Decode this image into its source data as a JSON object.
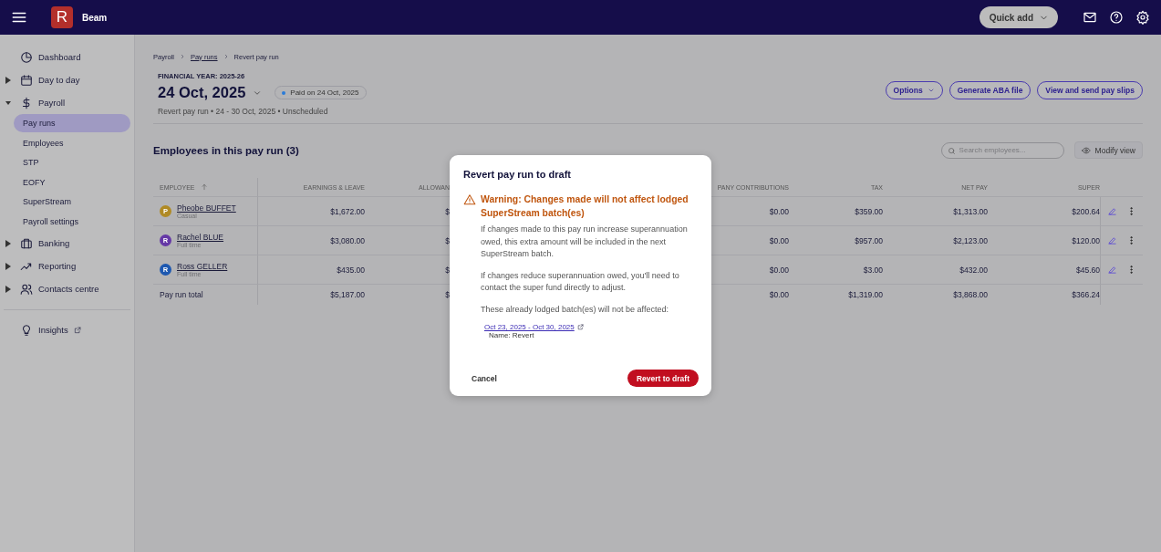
{
  "topbar": {
    "logo_letter": "R",
    "app_name": "Beam",
    "quick_add": "Quick add"
  },
  "sidebar": {
    "items": [
      {
        "label": "Dashboard",
        "kind": "link"
      },
      {
        "label": "Day to day",
        "kind": "group",
        "expanded": false
      },
      {
        "label": "Payroll",
        "kind": "group",
        "expanded": true,
        "children": [
          {
            "label": "Pay runs",
            "selected": true
          },
          {
            "label": "Employees",
            "selected": false
          },
          {
            "label": "STP",
            "selected": false
          },
          {
            "label": "EOFY",
            "selected": false
          },
          {
            "label": "SuperStream",
            "selected": false
          },
          {
            "label": "Payroll settings",
            "selected": false
          }
        ]
      },
      {
        "label": "Banking",
        "kind": "group",
        "expanded": false
      },
      {
        "label": "Reporting",
        "kind": "group",
        "expanded": false
      },
      {
        "label": "Contacts centre",
        "kind": "group",
        "expanded": false
      }
    ],
    "footer_link": {
      "label": "Insights"
    }
  },
  "breadcrumb": [
    {
      "label": "Payroll",
      "kind": "text"
    },
    {
      "label": "Pay runs",
      "kind": "link"
    },
    {
      "label": "Revert pay run",
      "kind": "text"
    }
  ],
  "header": {
    "financial_year": "FINANCIAL YEAR: 2025-26",
    "title": "24 Oct, 2025",
    "status": "Paid on 24 Oct, 2025",
    "subtitle": "Revert pay run • 24 - 30 Oct, 2025 • Unscheduled"
  },
  "actions": [
    {
      "label": "Options",
      "kind": "dropdown"
    },
    {
      "label": "Generate ABA file",
      "kind": "button"
    },
    {
      "label": "View and send pay slips",
      "kind": "button"
    }
  ],
  "section": {
    "title": "Employees in this pay run (3)",
    "search_placeholder": "Search employees...",
    "modify_view": "Modify view"
  },
  "table": {
    "employee_column": {
      "label": "EMPLOYEE",
      "sorted": true
    },
    "columns": [
      {
        "label": "EARNINGS & LEAVE",
        "sorted": false
      },
      {
        "label": "ALLOWAN",
        "sorted": false
      },
      {
        "label": "PANY CONTRIBUTIONS",
        "sorted": false
      },
      {
        "label": "TAX",
        "sorted": false
      },
      {
        "label": "NET PAY",
        "sorted": false
      },
      {
        "label": "SUPER",
        "sorted": false
      }
    ],
    "rows": [
      {
        "initial": "P",
        "color": "#b08a24",
        "name": "Pheobe BUFFET",
        "type": "Casual",
        "cells": [
          "$1,672.00",
          "$",
          "$0.00",
          "$359.00",
          "$1,313.00",
          "$200.64"
        ]
      },
      {
        "initial": "R",
        "color": "#6538a6",
        "name": "Rachel BLUE",
        "type": "Full time",
        "cells": [
          "$3,080.00",
          "$",
          "$0.00",
          "$957.00",
          "$2,123.00",
          "$120.00"
        ]
      },
      {
        "initial": "R",
        "color": "#1d58b0",
        "name": "Ross GELLER",
        "type": "Full time",
        "cells": [
          "$435.00",
          "$",
          "$0.00",
          "$3.00",
          "$432.00",
          "$45.60"
        ]
      }
    ],
    "total": {
      "label": "Pay run total",
      "cells": [
        "$5,187.00",
        "$",
        "$0.00",
        "$1,319.00",
        "$3,868.00",
        "$366.24"
      ]
    }
  },
  "modal": {
    "title": "Revert pay run to draft",
    "warning": "Warning: Changes made will not affect lodged SuperStream batch(es)",
    "paragraphs": [
      "If changes made to this pay run increase superannuation owed, this extra amount will be included in the next SuperStream batch.",
      "If changes reduce superannuation owed, you'll need to contact the super fund directly to adjust.",
      "These already lodged batch(es) will not be affected:"
    ],
    "batch_link": "Oct 23, 2025 - Oct 30, 2025",
    "batch_name": "Name: Revert",
    "cancel": "Cancel",
    "confirm": "Revert to draft"
  }
}
